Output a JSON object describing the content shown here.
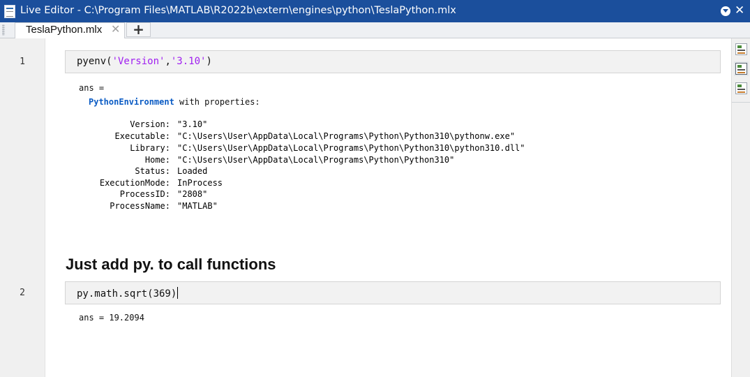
{
  "window": {
    "title": "Live Editor - C:\\Program Files\\MATLAB\\R2022b\\extern\\engines\\python\\TeslaPython.mlx"
  },
  "tabs": [
    {
      "label": "TeslaPython.mlx",
      "close": "✕"
    }
  ],
  "add_tab_label": "+",
  "cells": [
    {
      "line_number": "1",
      "code_prefix": "pyenv(",
      "code_str1": "'Version'",
      "code_sep": ",",
      "code_str2": "'3.10'",
      "code_suffix": ")",
      "output": {
        "ans_label": "ans =",
        "class_name": "PythonEnvironment",
        "class_suffix": " with properties:",
        "properties": [
          {
            "key": "Version:",
            "value": "\"3.10\""
          },
          {
            "key": "Executable:",
            "value": "\"C:\\Users\\User\\AppData\\Local\\Programs\\Python\\Python310\\pythonw.exe\""
          },
          {
            "key": "Library:",
            "value": "\"C:\\Users\\User\\AppData\\Local\\Programs\\Python\\Python310\\python310.dll\""
          },
          {
            "key": "Home:",
            "value": "\"C:\\Users\\User\\AppData\\Local\\Programs\\Python\\Python310\""
          },
          {
            "key": "Status:",
            "value": "Loaded"
          },
          {
            "key": "ExecutionMode:",
            "value": "InProcess"
          },
          {
            "key": "ProcessID:",
            "value": "\"2808\""
          },
          {
            "key": "ProcessName:",
            "value": "\"MATLAB\""
          }
        ]
      }
    },
    {
      "line_number": "2",
      "code": "py.math.sqrt(369)",
      "output": "ans = 19.2094"
    }
  ],
  "section_heading": "Just add py. to call functions",
  "right_toolbar": [
    {
      "icon": "output-right-icon"
    },
    {
      "icon": "output-inline-icon",
      "active": true
    },
    {
      "icon": "hide-code-icon"
    }
  ]
}
